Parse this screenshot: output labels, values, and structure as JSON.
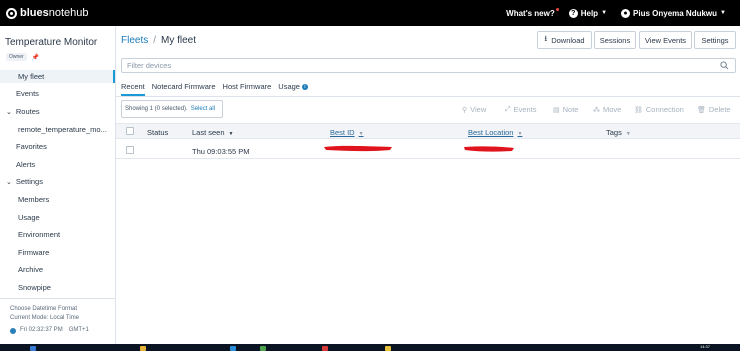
{
  "topbar": {
    "brand_bold": "blues",
    "brand_rest": " notehub",
    "whats_new": "What's new?",
    "help": "Help",
    "user": "Pius Onyema Ndukwu"
  },
  "sidebar": {
    "project_title": "Temperature Monitor",
    "owner_badge": "Owner",
    "items": [
      {
        "label": "My fleet"
      },
      {
        "label": "Events"
      },
      {
        "label": "Routes"
      },
      {
        "label": "remote_temperature_mo..."
      },
      {
        "label": "Favorites"
      },
      {
        "label": "Alerts"
      },
      {
        "label": "Settings"
      },
      {
        "label": "Members"
      },
      {
        "label": "Usage"
      },
      {
        "label": "Environment"
      },
      {
        "label": "Firmware"
      },
      {
        "label": "Archive"
      },
      {
        "label": "Snowpipe"
      }
    ],
    "datetime_line1": "Choose Datetime Format",
    "datetime_line2": "Current Mode: Local Time",
    "datetime_time": "Fri 02:32:37 PM",
    "datetime_tz": "GMT+1"
  },
  "main": {
    "breadcrumb_parent": "Fleets",
    "breadcrumb_sep": "/",
    "breadcrumb_current": "My fleet",
    "buttons": {
      "download": "Download",
      "sessions": "Sessions",
      "view_events": "View Events",
      "settings": "Settings"
    },
    "filter_placeholder": "Filter devices",
    "tabs": [
      "Recent",
      "Notecard Firmware",
      "Host Firmware",
      "Usage"
    ],
    "showing_text": "Showing 1 (0 selected).",
    "select_all": "Select all",
    "actions": [
      "View",
      "Events",
      "Note",
      "Move",
      "Connection",
      "Delete"
    ],
    "columns": [
      "Status",
      "Last seen",
      "Best ID",
      "Best Location",
      "Tags"
    ],
    "rows": [
      {
        "status": "",
        "last_seen": "Thu 09:03:55 PM",
        "best_id": "",
        "best_location": "",
        "tags": ""
      }
    ]
  },
  "taskbar": {
    "time": "14:37"
  },
  "colors": {
    "accent": "#1a9bd7",
    "link": "#1a7bb8",
    "redaction": "#e0141c",
    "topbar": "#000000"
  }
}
